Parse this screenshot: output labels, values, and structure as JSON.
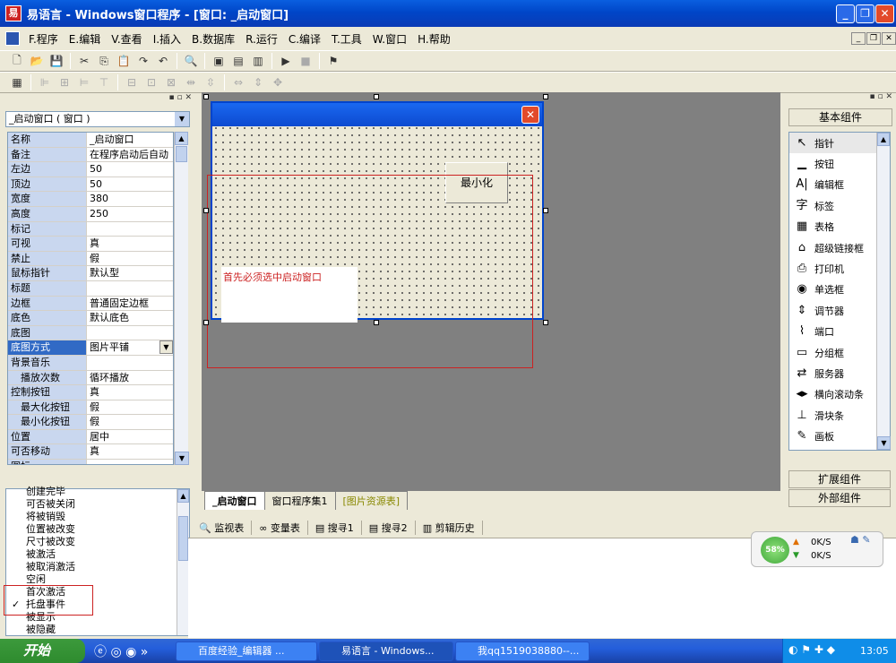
{
  "window": {
    "title": "易语言 - Windows窗口程序 - [窗口: _启动窗口]",
    "icon_text": "易"
  },
  "menu": [
    "F.程序",
    "E.编辑",
    "V.查看",
    "I.插入",
    "B.数据库",
    "R.运行",
    "C.编译",
    "T.工具",
    "W.窗口",
    "H.帮助"
  ],
  "object_combo": "_启动窗口 ( 窗口 )",
  "properties": [
    {
      "name": "名称",
      "value": "_启动窗口"
    },
    {
      "name": "备注",
      "value": "在程序启动后自动"
    },
    {
      "name": "左边",
      "value": "50"
    },
    {
      "name": "顶边",
      "value": "50"
    },
    {
      "name": "宽度",
      "value": "380"
    },
    {
      "name": "高度",
      "value": "250"
    },
    {
      "name": "标记",
      "value": ""
    },
    {
      "name": "可视",
      "value": "真"
    },
    {
      "name": "禁止",
      "value": "假"
    },
    {
      "name": "鼠标指针",
      "value": "默认型"
    },
    {
      "name": "标题",
      "value": ""
    },
    {
      "name": "边框",
      "value": "普通固定边框"
    },
    {
      "name": "底色",
      "value": "默认底色"
    },
    {
      "name": "底图",
      "value": ""
    },
    {
      "name": "底图方式",
      "value": "图片平铺",
      "selected": true
    },
    {
      "name": "背景音乐",
      "value": ""
    },
    {
      "name": "播放次数",
      "value": "循环播放",
      "sub": true
    },
    {
      "name": "控制按钮",
      "value": "真"
    },
    {
      "name": "最大化按钮",
      "value": "假",
      "sub": true
    },
    {
      "name": "最小化按钮",
      "value": "假",
      "sub": true
    },
    {
      "name": "位置",
      "value": "居中"
    },
    {
      "name": "可否移动",
      "value": "真"
    },
    {
      "name": "图标",
      "value": ""
    }
  ],
  "design": {
    "minimize_button": "最小化",
    "annotation": "首先必须选中启动窗口"
  },
  "editor_tabs": [
    "_启动窗口",
    "窗口程序集1",
    "[图片资源表]"
  ],
  "components": {
    "basic_header": "基本组件",
    "items": [
      {
        "icon": "pointer-icon",
        "glyph": "↖",
        "label": "指针"
      },
      {
        "icon": "button-icon",
        "glyph": "▁",
        "label": "按钮"
      },
      {
        "icon": "editbox-icon",
        "glyph": "A|",
        "label": "编辑框"
      },
      {
        "icon": "label-icon",
        "glyph": "字",
        "label": "标签"
      },
      {
        "icon": "table-icon",
        "glyph": "▦",
        "label": "表格"
      },
      {
        "icon": "hyperlink-icon",
        "glyph": "⌂",
        "label": "超级链接框"
      },
      {
        "icon": "printer-icon",
        "glyph": "⎙",
        "label": "打印机"
      },
      {
        "icon": "radio-icon",
        "glyph": "◉",
        "label": "单选框"
      },
      {
        "icon": "spinner-icon",
        "glyph": "⇕",
        "label": "调节器"
      },
      {
        "icon": "port-icon",
        "glyph": "⌇",
        "label": "端口"
      },
      {
        "icon": "groupbox-icon",
        "glyph": "▭",
        "label": "分组框"
      },
      {
        "icon": "server-icon",
        "glyph": "⇄",
        "label": "服务器"
      },
      {
        "icon": "hscroll-icon",
        "glyph": "◂▸",
        "label": "横向滚动条"
      },
      {
        "icon": "slider-icon",
        "glyph": "⊥",
        "label": "滑块条"
      },
      {
        "icon": "canvas-icon",
        "glyph": "✎",
        "label": "画板"
      }
    ],
    "ext_header": "扩展组件",
    "ext2_header": "外部组件"
  },
  "events": [
    "创建完毕",
    "可否被关闭",
    "将被销毁",
    "位置被改变",
    "尺寸被改变",
    "被激活",
    "被取消激活",
    "空闲",
    "首次激活",
    "托盘事件",
    "被显示",
    "被隐藏"
  ],
  "events_checked": "托盘事件",
  "bottom_tabs": [
    "监视表",
    "变量表",
    "搜寻1",
    "搜寻2",
    "剪辑历史"
  ],
  "netmon": {
    "percent": "58%",
    "up": "0K/S",
    "down": "0K/S"
  },
  "taskbar": {
    "start": "开始",
    "tasks": [
      "百度经验_编辑器 ...",
      "易语言 - Windows...",
      "我qq1519038880--..."
    ],
    "clock": "13:05"
  },
  "colors": {
    "title_blue": "#0046c8",
    "annotation_red": "#cc2222"
  }
}
